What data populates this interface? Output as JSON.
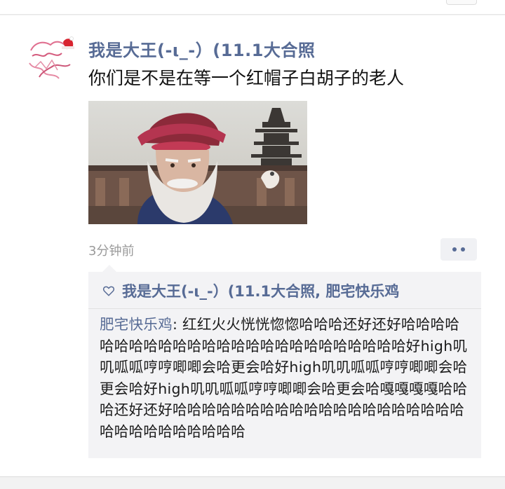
{
  "post": {
    "author": "我是大王(-ι_-）(11.1大合照",
    "text": "你们是不是在等一个红帽子白胡子的老人",
    "time": "3分钟前"
  },
  "likes": {
    "names": "我是大王(-ι_-）(11.1大合照, 肥宅快乐鸡"
  },
  "comment": {
    "author": "肥宅快乐鸡",
    "separator": ": ",
    "text": "红红火火恍恍惚惚哈哈哈还好还好哈哈哈哈哈哈哈哈哈哈哈哈哈哈哈哈哈哈哈哈哈哈哈哈哈好high叽叽呱呱哼哼唧唧会哈更会哈好high叽叽呱呱哼哼唧唧会哈更会哈好high叽叽呱呱哼哼唧唧会哈更会哈嘎嘎嘎嘎哈哈哈还好还好哈哈哈哈哈哈哈哈哈哈哈哈哈哈哈哈哈哈哈哈哈哈哈哈哈哈哈哈哈哈"
  },
  "icons": {
    "like": "heart-outline-icon",
    "more": "more-dots-icon"
  },
  "colors": {
    "link": "#576b95",
    "text": "#111111",
    "muted": "#9a9a9a",
    "comment_bg": "#f3f3f5"
  }
}
